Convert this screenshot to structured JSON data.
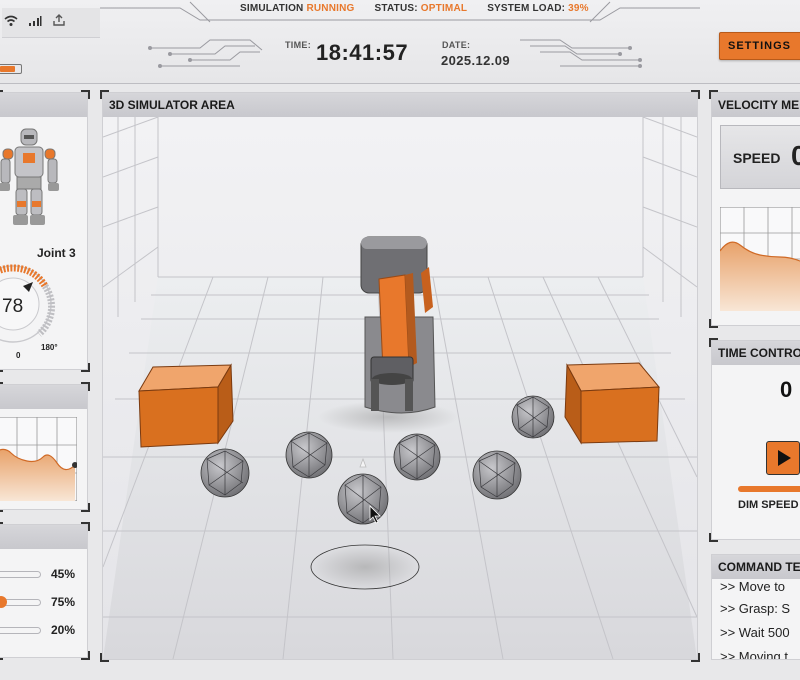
{
  "header": {
    "simulation_label": "SIMULATION",
    "simulation_state": "RUNNING",
    "status_label": "STATUS:",
    "status_value": "OPTIMAL",
    "load_label": "SYSTEM LOAD:",
    "load_value": "39%",
    "time_label": "TIME:",
    "time_value": "18:41:57",
    "date_label": "DATE:",
    "date_value": "2025.12.09",
    "settings_label": "SETTINGS",
    "icons": [
      "wifi-icon",
      "signal-icon",
      "upload-icon",
      "battery-icon"
    ]
  },
  "robot_panel": {
    "joint_label": "Joint 3",
    "gauge_value": "78",
    "gauge_min": "0",
    "gauge_max": "180°"
  },
  "sliders": [
    {
      "value": "45%",
      "level": 0.45
    },
    {
      "value": "75%",
      "level": 0.75
    },
    {
      "value": "20%",
      "level": 0.2
    }
  ],
  "sim_panel": {
    "title": "3D SIMULATOR AREA"
  },
  "velocity_panel": {
    "title": "VELOCITY ME",
    "speed_label": "SPEED",
    "speed_value": "0"
  },
  "time_panel": {
    "title": "TIME CONTRO",
    "time_value": "0",
    "dim_label": "DIM SPEED"
  },
  "command_panel": {
    "title": "COMMAND TE",
    "lines": [
      ">> Move to",
      ">> Grasp: S",
      ">> Wait 500",
      ">> Moving t"
    ]
  },
  "colors": {
    "accent": "#e8782c",
    "panel_bg": "#f4f4f5",
    "header_bg": "#c8c8cd"
  }
}
